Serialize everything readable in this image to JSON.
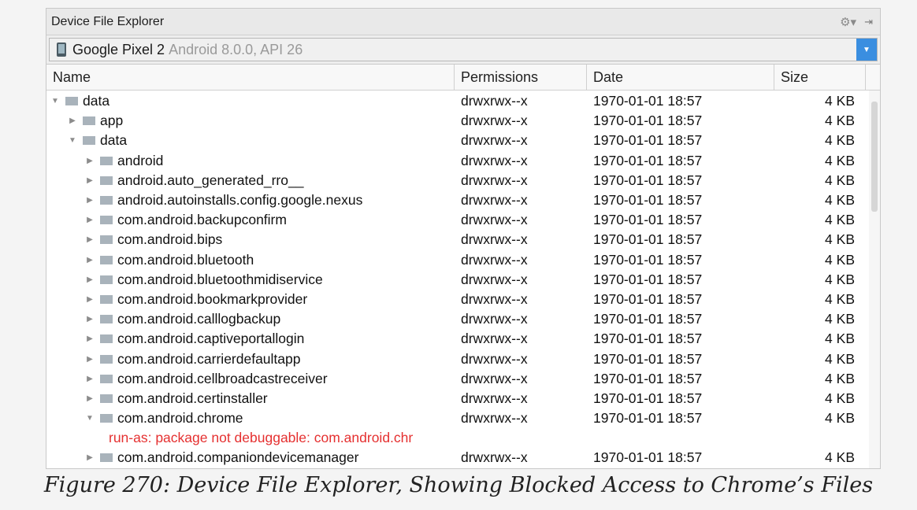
{
  "panel": {
    "title": "Device File Explorer",
    "gear_icon": "gear-icon",
    "hide_icon": "hide-panel-icon"
  },
  "device": {
    "name": "Google Pixel 2",
    "info": "Android 8.0.0, API 26"
  },
  "columns": [
    "Name",
    "Permissions",
    "Date",
    "Size"
  ],
  "rows": [
    {
      "level": 0,
      "expanded": true,
      "name": "data",
      "perm": "drwxrwx--x",
      "date": "1970-01-01 18:57",
      "size": "4 KB"
    },
    {
      "level": 1,
      "expanded": false,
      "name": "app",
      "perm": "drwxrwx--x",
      "date": "1970-01-01 18:57",
      "size": "4 KB"
    },
    {
      "level": 1,
      "expanded": true,
      "name": "data",
      "perm": "drwxrwx--x",
      "date": "1970-01-01 18:57",
      "size": "4 KB"
    },
    {
      "level": 2,
      "expanded": false,
      "name": "android",
      "perm": "drwxrwx--x",
      "date": "1970-01-01 18:57",
      "size": "4 KB"
    },
    {
      "level": 2,
      "expanded": false,
      "name": "android.auto_generated_rro__",
      "perm": "drwxrwx--x",
      "date": "1970-01-01 18:57",
      "size": "4 KB"
    },
    {
      "level": 2,
      "expanded": false,
      "name": "android.autoinstalls.config.google.nexus",
      "perm": "drwxrwx--x",
      "date": "1970-01-01 18:57",
      "size": "4 KB"
    },
    {
      "level": 2,
      "expanded": false,
      "name": "com.android.backupconfirm",
      "perm": "drwxrwx--x",
      "date": "1970-01-01 18:57",
      "size": "4 KB"
    },
    {
      "level": 2,
      "expanded": false,
      "name": "com.android.bips",
      "perm": "drwxrwx--x",
      "date": "1970-01-01 18:57",
      "size": "4 KB"
    },
    {
      "level": 2,
      "expanded": false,
      "name": "com.android.bluetooth",
      "perm": "drwxrwx--x",
      "date": "1970-01-01 18:57",
      "size": "4 KB"
    },
    {
      "level": 2,
      "expanded": false,
      "name": "com.android.bluetoothmidiservice",
      "perm": "drwxrwx--x",
      "date": "1970-01-01 18:57",
      "size": "4 KB"
    },
    {
      "level": 2,
      "expanded": false,
      "name": "com.android.bookmarkprovider",
      "perm": "drwxrwx--x",
      "date": "1970-01-01 18:57",
      "size": "4 KB"
    },
    {
      "level": 2,
      "expanded": false,
      "name": "com.android.calllogbackup",
      "perm": "drwxrwx--x",
      "date": "1970-01-01 18:57",
      "size": "4 KB"
    },
    {
      "level": 2,
      "expanded": false,
      "name": "com.android.captiveportallogin",
      "perm": "drwxrwx--x",
      "date": "1970-01-01 18:57",
      "size": "4 KB"
    },
    {
      "level": 2,
      "expanded": false,
      "name": "com.android.carrierdefaultapp",
      "perm": "drwxrwx--x",
      "date": "1970-01-01 18:57",
      "size": "4 KB"
    },
    {
      "level": 2,
      "expanded": false,
      "name": "com.android.cellbroadcastreceiver",
      "perm": "drwxrwx--x",
      "date": "1970-01-01 18:57",
      "size": "4 KB"
    },
    {
      "level": 2,
      "expanded": false,
      "name": "com.android.certinstaller",
      "perm": "drwxrwx--x",
      "date": "1970-01-01 18:57",
      "size": "4 KB"
    },
    {
      "level": 2,
      "expanded": true,
      "name": "com.android.chrome",
      "perm": "drwxrwx--x",
      "date": "1970-01-01 18:57",
      "size": "4 KB"
    },
    {
      "level": 3,
      "error": "run-as: package not debuggable: com.android.chr"
    },
    {
      "level": 2,
      "expanded": false,
      "name": "com.android.companiondevicemanager",
      "perm": "drwxrwx--x",
      "date": "1970-01-01 18:57",
      "size": "4 KB"
    }
  ],
  "caption": "Figure 270: Device File Explorer, Showing Blocked Access to Chrome’s Files"
}
